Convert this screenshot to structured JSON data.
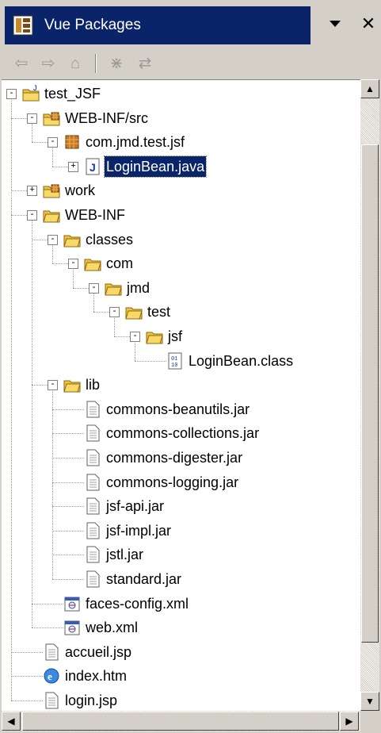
{
  "view": {
    "title": "Vue Packages",
    "menu_icon": "chevron-down-icon",
    "close_icon": "close-icon",
    "toolbar": [
      "back-arrow-icon",
      "forward-arrow-icon",
      "up-folder-icon",
      "collapse-all-icon",
      "link-editor-icon"
    ]
  },
  "tree": [
    {
      "label": "test_JSF",
      "level": 0,
      "icon": "project",
      "toggle": "-"
    },
    {
      "label": "WEB-INF/src",
      "level": 1,
      "icon": "src-folder",
      "toggle": "-"
    },
    {
      "label": "com.jmd.test.jsf",
      "level": 2,
      "icon": "package",
      "toggle": "-"
    },
    {
      "label": "LoginBean.java",
      "level": 3,
      "icon": "java",
      "toggle": "+",
      "selected": true
    },
    {
      "label": "work",
      "level": 1,
      "icon": "src-folder",
      "toggle": "+"
    },
    {
      "label": "WEB-INF",
      "level": 1,
      "icon": "folder",
      "toggle": "-"
    },
    {
      "label": "classes",
      "level": 2,
      "icon": "folder",
      "toggle": "-"
    },
    {
      "label": "com",
      "level": 3,
      "icon": "folder",
      "toggle": "-"
    },
    {
      "label": "jmd",
      "level": 4,
      "icon": "folder",
      "toggle": "-"
    },
    {
      "label": "test",
      "level": 5,
      "icon": "folder",
      "toggle": "-"
    },
    {
      "label": "jsf",
      "level": 6,
      "icon": "folder",
      "toggle": "-"
    },
    {
      "label": "LoginBean.class",
      "level": 7,
      "icon": "class"
    },
    {
      "label": "lib",
      "level": 2,
      "icon": "folder",
      "toggle": "-"
    },
    {
      "label": "commons-beanutils.jar",
      "level": 3,
      "icon": "file"
    },
    {
      "label": "commons-collections.jar",
      "level": 3,
      "icon": "file"
    },
    {
      "label": "commons-digester.jar",
      "level": 3,
      "icon": "file"
    },
    {
      "label": "commons-logging.jar",
      "level": 3,
      "icon": "file"
    },
    {
      "label": "jsf-api.jar",
      "level": 3,
      "icon": "file"
    },
    {
      "label": "jsf-impl.jar",
      "level": 3,
      "icon": "file"
    },
    {
      "label": "jstl.jar",
      "level": 3,
      "icon": "file"
    },
    {
      "label": "standard.jar",
      "level": 3,
      "icon": "file"
    },
    {
      "label": "faces-config.xml",
      "level": 2,
      "icon": "xml"
    },
    {
      "label": "web.xml",
      "level": 2,
      "icon": "xml"
    },
    {
      "label": "accueil.jsp",
      "level": 1,
      "icon": "file"
    },
    {
      "label": "index.htm",
      "level": 1,
      "icon": "html"
    },
    {
      "label": "login.jsp",
      "level": 1,
      "icon": "file"
    }
  ]
}
